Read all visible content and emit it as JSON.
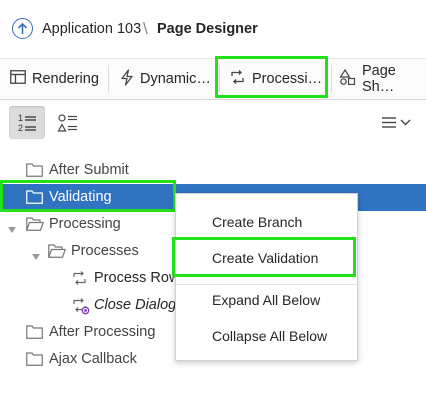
{
  "header": {
    "app_name": "Application 103",
    "separator": "\\",
    "page_name": "Page Designer"
  },
  "tabs": [
    {
      "label": "Rendering",
      "icon": "rendering-icon"
    },
    {
      "label": "Dynamic…",
      "icon": "lightning-icon"
    },
    {
      "label": "Processi…",
      "icon": "processing-icon",
      "highlighted": true
    },
    {
      "label": "Page Sh…",
      "icon": "shapes-icon"
    }
  ],
  "tree": {
    "nodes": [
      {
        "label": "After Submit",
        "italic": false
      },
      {
        "label": "Validating",
        "selected": true
      },
      {
        "label": "Processing"
      },
      {
        "label": "Processes"
      },
      {
        "label": "Process Row"
      },
      {
        "label": "Close Dialog",
        "italic": true
      },
      {
        "label": "After Processing"
      },
      {
        "label": "Ajax Callback"
      }
    ]
  },
  "context_menu": {
    "items": [
      {
        "label": "Create Branch"
      },
      {
        "label": "Create Validation",
        "highlighted": true
      },
      {
        "label": "Expand All Below"
      },
      {
        "label": "Collapse All Below"
      }
    ]
  },
  "colors": {
    "selected_bg": "#2f73c1",
    "highlight": "#22e11a",
    "link_blue": "#3c6fb3"
  }
}
